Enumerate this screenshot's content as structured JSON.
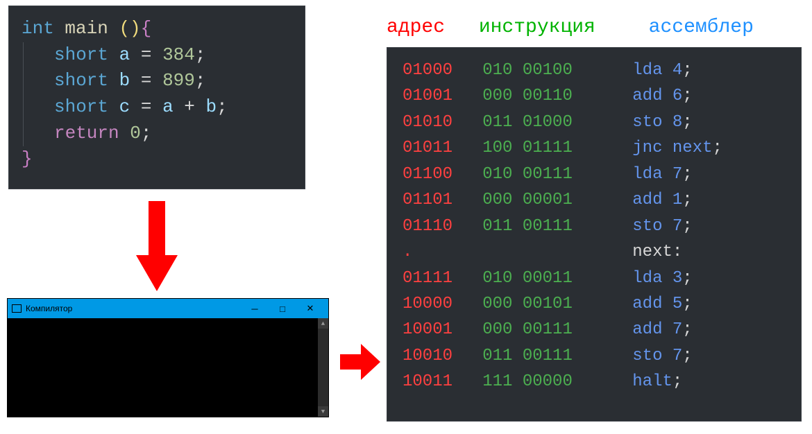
{
  "source_code": {
    "lines": [
      {
        "tokens": [
          {
            "cls": "tok-type",
            "t": "int"
          },
          {
            "cls": "tok-plain",
            "t": " "
          },
          {
            "cls": "tok-fn",
            "t": "main"
          },
          {
            "cls": "tok-plain",
            "t": " "
          },
          {
            "cls": "tok-pun",
            "t": "()"
          },
          {
            "cls": "tok-brace",
            "t": "{"
          }
        ],
        "indent": 0
      },
      {
        "tokens": [
          {
            "cls": "tok-type",
            "t": "short"
          },
          {
            "cls": "tok-plain",
            "t": " "
          },
          {
            "cls": "tok-var",
            "t": "a"
          },
          {
            "cls": "tok-plain",
            "t": " "
          },
          {
            "cls": "tok-op",
            "t": "="
          },
          {
            "cls": "tok-plain",
            "t": " "
          },
          {
            "cls": "tok-num",
            "t": "384"
          },
          {
            "cls": "tok-plain",
            "t": ";"
          }
        ],
        "indent": 1
      },
      {
        "tokens": [
          {
            "cls": "tok-type",
            "t": "short"
          },
          {
            "cls": "tok-plain",
            "t": " "
          },
          {
            "cls": "tok-var",
            "t": "b"
          },
          {
            "cls": "tok-plain",
            "t": " "
          },
          {
            "cls": "tok-op",
            "t": "="
          },
          {
            "cls": "tok-plain",
            "t": " "
          },
          {
            "cls": "tok-num",
            "t": "899"
          },
          {
            "cls": "tok-plain",
            "t": ";"
          }
        ],
        "indent": 1
      },
      {
        "tokens": [
          {
            "cls": "tok-type",
            "t": "short"
          },
          {
            "cls": "tok-plain",
            "t": " "
          },
          {
            "cls": "tok-var",
            "t": "c"
          },
          {
            "cls": "tok-plain",
            "t": " "
          },
          {
            "cls": "tok-op",
            "t": "="
          },
          {
            "cls": "tok-plain",
            "t": " "
          },
          {
            "cls": "tok-var",
            "t": "a"
          },
          {
            "cls": "tok-plain",
            "t": " "
          },
          {
            "cls": "tok-op",
            "t": "+"
          },
          {
            "cls": "tok-plain",
            "t": " "
          },
          {
            "cls": "tok-var",
            "t": "b"
          },
          {
            "cls": "tok-plain",
            "t": ";"
          }
        ],
        "indent": 1
      },
      {
        "tokens": [
          {
            "cls": "tok-kw",
            "t": "return"
          },
          {
            "cls": "tok-plain",
            "t": " "
          },
          {
            "cls": "tok-num",
            "t": "0"
          },
          {
            "cls": "tok-plain",
            "t": ";"
          }
        ],
        "indent": 1
      },
      {
        "tokens": [
          {
            "cls": "tok-brace",
            "t": "}"
          }
        ],
        "indent": 0
      }
    ]
  },
  "console": {
    "title": "Компилятор"
  },
  "asm_headers": {
    "addr": "адрес",
    "instr": "инструкция",
    "asm": "ассемблер"
  },
  "asm_rows": [
    {
      "addr": "01000",
      "instr": "010 00100",
      "asm": "lda 4",
      "label": false
    },
    {
      "addr": "01001",
      "instr": "000 00110",
      "asm": "add 6",
      "label": false
    },
    {
      "addr": "01010",
      "instr": "011 01000",
      "asm": "sto 8",
      "label": false
    },
    {
      "addr": "01011",
      "instr": "100 01111",
      "asm": "jnc next",
      "label": false
    },
    {
      "addr": "01100",
      "instr": "010 00111",
      "asm": "lda 7",
      "label": false
    },
    {
      "addr": "01101",
      "instr": "000 00001",
      "asm": "add 1",
      "label": false
    },
    {
      "addr": "01110",
      "instr": "011 00111",
      "asm": "sto 7",
      "label": false
    },
    {
      "addr": ".",
      "instr": "",
      "asm": "next:",
      "label": true
    },
    {
      "addr": "01111",
      "instr": "010 00011",
      "asm": "lda 3",
      "label": false
    },
    {
      "addr": "10000",
      "instr": "000 00101",
      "asm": "add 5",
      "label": false
    },
    {
      "addr": "10001",
      "instr": "000 00111",
      "asm": "add 7",
      "label": false
    },
    {
      "addr": "10010",
      "instr": "011 00111",
      "asm": "sto 7",
      "label": false
    },
    {
      "addr": "10011",
      "instr": "111 00000",
      "asm": "halt",
      "label": false
    }
  ]
}
